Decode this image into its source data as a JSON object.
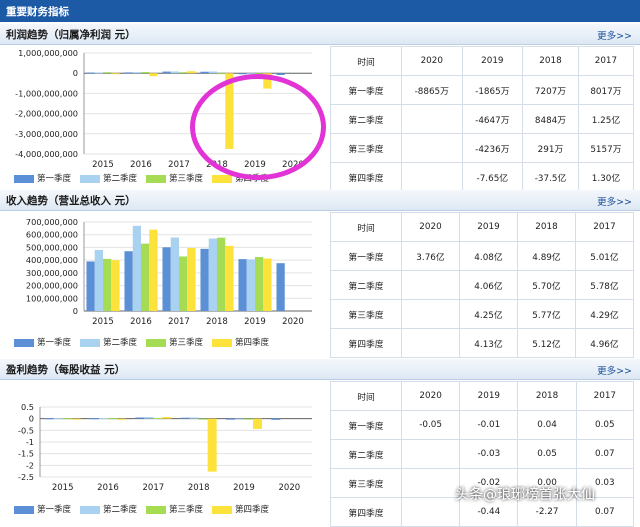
{
  "app_title": "重要财务指标",
  "more_label": "更多>>",
  "colors": {
    "q1": "#5b8fd6",
    "q2": "#a8d2f0",
    "q3": "#a5dc54",
    "q4": "#fde23c",
    "header": "#1d5aa5",
    "highlight": "#e233d6"
  },
  "legend": [
    "第一季度",
    "第二季度",
    "第三季度",
    "第四季度"
  ],
  "table_headers": [
    "时间",
    "2020",
    "2019",
    "2018",
    "2017"
  ],
  "row_labels": [
    "第一季度",
    "第二季度",
    "第三季度",
    "第四季度"
  ],
  "watermark": "头条@琅琊榜首张大仙",
  "sections": [
    {
      "title": "利润趋势（归属净利润 元）",
      "chart_data": {
        "type": "bar",
        "categories": [
          "2015",
          "2016",
          "2017",
          "2018",
          "2019",
          "2020"
        ],
        "y_ticks": [
          "1,000,000,000",
          "0",
          "-1,000,000,000",
          "-2,000,000,000",
          "-3,000,000,000",
          "-4,000,000,000"
        ],
        "ylim": [
          -4000000000,
          1000000000
        ],
        "series": [
          {
            "name": "第一季度",
            "values": [
              30000000,
              40000000,
              80000000,
              72070000,
              -18650000,
              -88650000
            ]
          },
          {
            "name": "第二季度",
            "values": [
              40000000,
              50000000,
              84840000,
              84840000,
              -46470000,
              null
            ]
          },
          {
            "name": "第三季度",
            "values": [
              50000000,
              60000000,
              51570000,
              2910000,
              -42360000,
              null
            ]
          },
          {
            "name": "第四季度",
            "values": [
              -20000000,
              -150000000,
              100000000,
              -3750000000,
              -765000000,
              null
            ]
          }
        ]
      },
      "table": [
        [
          "-8865万",
          "-1865万",
          "7207万",
          "8017万"
        ],
        [
          "",
          "-4647万",
          "8484万",
          "1.25亿"
        ],
        [
          "",
          "-4236万",
          "291万",
          "5157万"
        ],
        [
          "",
          "-7.65亿",
          "-37.5亿",
          "1.30亿"
        ]
      ]
    },
    {
      "title": "收入趋势（营业总收入 元）",
      "chart_data": {
        "type": "bar",
        "categories": [
          "2015",
          "2016",
          "2017",
          "2018",
          "2019",
          "2020"
        ],
        "y_ticks": [
          "700,000,000",
          "600,000,000",
          "500,000,000",
          "400,000,000",
          "300,000,000",
          "200,000,000",
          "100,000,000",
          "0"
        ],
        "ylim": [
          0,
          700000000
        ],
        "series": [
          {
            "name": "第一季度",
            "values": [
              390000000,
              470000000,
              501000000,
              489000000,
              408000000,
              376000000
            ]
          },
          {
            "name": "第二季度",
            "values": [
              480000000,
              670000000,
              578000000,
              570000000,
              406000000,
              null
            ]
          },
          {
            "name": "第三季度",
            "values": [
              410000000,
              530000000,
              429000000,
              577000000,
              425000000,
              null
            ]
          },
          {
            "name": "第四季度",
            "values": [
              400000000,
              640000000,
              496000000,
              512000000,
              413000000,
              null
            ]
          }
        ]
      },
      "table": [
        [
          "3.76亿",
          "4.08亿",
          "4.89亿",
          "5.01亿"
        ],
        [
          "",
          "4.06亿",
          "5.70亿",
          "5.78亿"
        ],
        [
          "",
          "4.25亿",
          "5.77亿",
          "4.29亿"
        ],
        [
          "",
          "4.13亿",
          "5.12亿",
          "4.96亿"
        ]
      ]
    },
    {
      "title": "盈利趋势（每股收益 元）",
      "chart_data": {
        "type": "bar",
        "categories": [
          "2015",
          "2016",
          "2017",
          "2018",
          "2019",
          "2020"
        ],
        "y_ticks": [
          "0.5",
          "0",
          "-0.5",
          "-1",
          "-1.5",
          "-2",
          "-2.5"
        ],
        "ylim": [
          -2.5,
          0.5
        ],
        "series": [
          {
            "name": "第一季度",
            "values": [
              0.02,
              0.02,
              0.05,
              0.04,
              -0.01,
              -0.05
            ]
          },
          {
            "name": "第二季度",
            "values": [
              0.02,
              0.03,
              0.07,
              0.05,
              -0.03,
              null
            ]
          },
          {
            "name": "第三季度",
            "values": [
              0.02,
              0.02,
              0.03,
              0.0,
              -0.02,
              null
            ]
          },
          {
            "name": "第四季度",
            "values": [
              -0.02,
              -0.05,
              0.07,
              -2.27,
              -0.44,
              null
            ]
          }
        ]
      },
      "table": [
        [
          "-0.05",
          "-0.01",
          "0.04",
          "0.05"
        ],
        [
          "",
          "-0.03",
          "0.05",
          "0.07"
        ],
        [
          "",
          "-0.02",
          "0.00",
          "0.03"
        ],
        [
          "",
          "-0.44",
          "-2.27",
          "0.07"
        ]
      ]
    }
  ]
}
